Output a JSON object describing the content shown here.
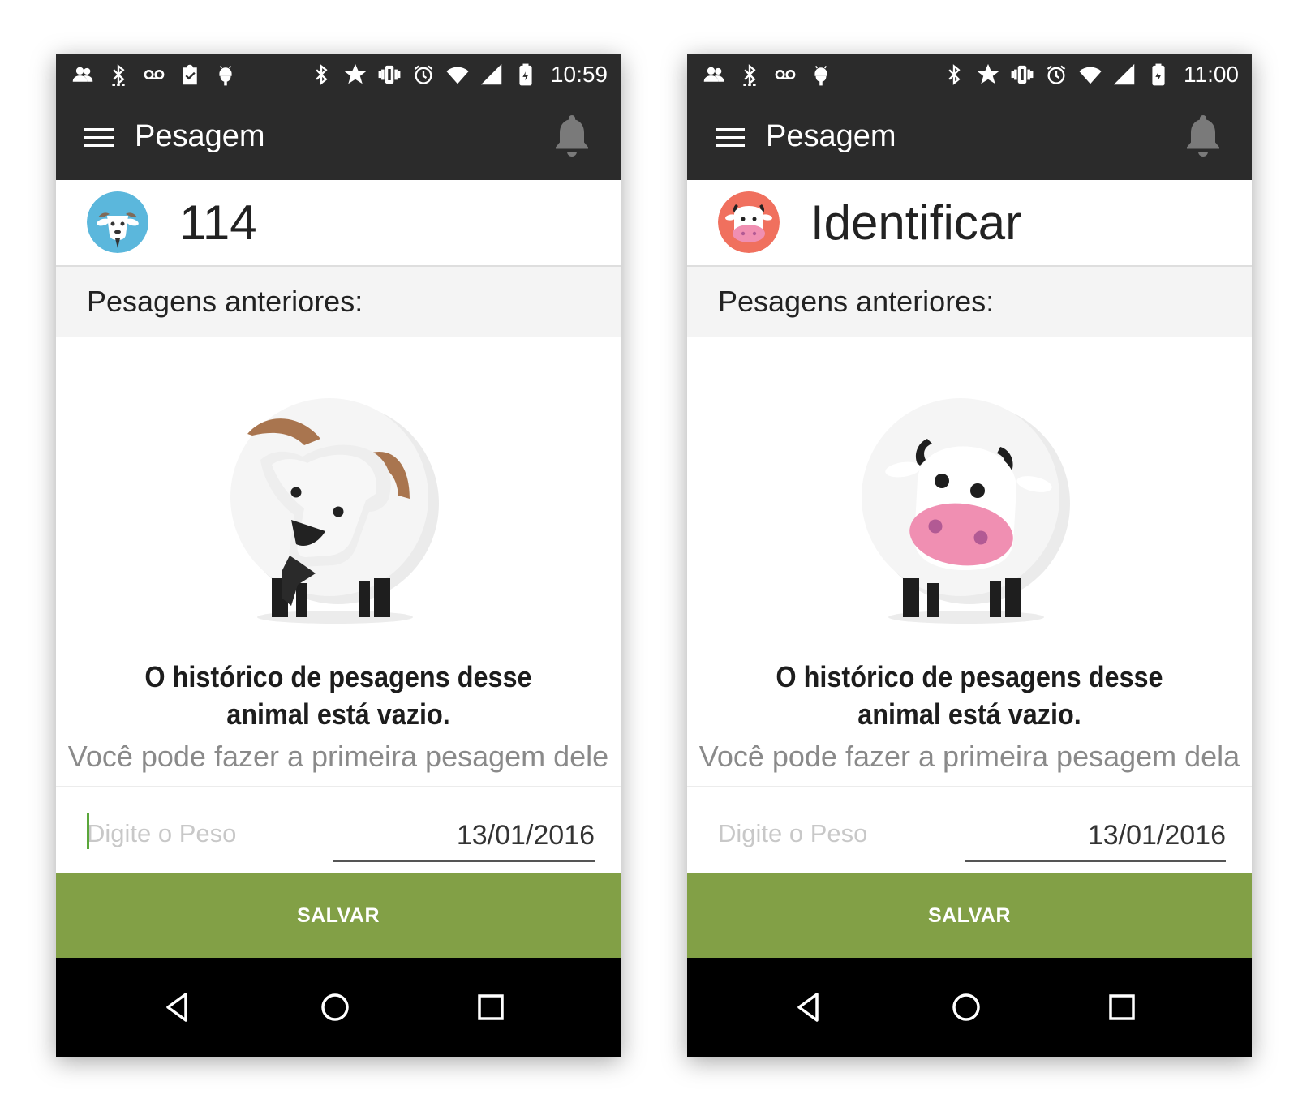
{
  "screens": [
    {
      "status": {
        "left_icons": [
          "people-icon",
          "bluetooth-icon",
          "voicemail-icon",
          "clipboard-icon",
          "android-debug-icon"
        ],
        "right_icons": [
          "bluetooth-icon",
          "star-icon",
          "vibrate-icon",
          "alarm-icon",
          "wifi-icon",
          "signal-icon",
          "battery-icon"
        ],
        "time": "10:59"
      },
      "toolbar": {
        "title": "Pesagem",
        "menu_icon": "menu-icon",
        "bell_icon": "bell-icon"
      },
      "animal": {
        "id_label": "114",
        "avatar": "goat-avatar",
        "avatar_bg": "#5bb7dc"
      },
      "history": {
        "heading": "Pesagens anteriores:",
        "illustration": "goat-illustration",
        "empty_title": "O histórico de pesagens desse animal está vazio.",
        "empty_subtitle": "Você pode fazer a primeira pesagem dele"
      },
      "form": {
        "weight_placeholder": "Digite o Peso",
        "weight_value": "",
        "date": "13/01/2016",
        "save_label": "SALVAR"
      }
    },
    {
      "status": {
        "left_icons": [
          "people-icon",
          "bluetooth-icon",
          "voicemail-icon",
          "android-debug-icon"
        ],
        "right_icons": [
          "bluetooth-icon",
          "star-icon",
          "vibrate-icon",
          "alarm-icon",
          "wifi-icon",
          "signal-icon",
          "battery-icon"
        ],
        "time": "11:00"
      },
      "toolbar": {
        "title": "Pesagem",
        "menu_icon": "menu-icon",
        "bell_icon": "bell-icon"
      },
      "animal": {
        "id_label": "Identificar",
        "avatar": "cow-avatar",
        "avatar_bg": "#f0705e"
      },
      "history": {
        "heading": "Pesagens anteriores:",
        "illustration": "cow-illustration",
        "empty_title": "O histórico de pesagens desse animal está vazio.",
        "empty_subtitle": "Você pode fazer a primeira pesagem dela"
      },
      "form": {
        "weight_placeholder": "Digite o Peso",
        "weight_value": "",
        "date": "13/01/2016",
        "save_label": "SALVAR"
      }
    }
  ],
  "colors": {
    "toolbar": "#2b2b2b",
    "save_button": "#82a046",
    "navbar": "#000000",
    "cursor": "#5aa63a"
  },
  "navigation": {
    "icons": [
      "back-icon",
      "home-icon",
      "recents-icon"
    ]
  }
}
